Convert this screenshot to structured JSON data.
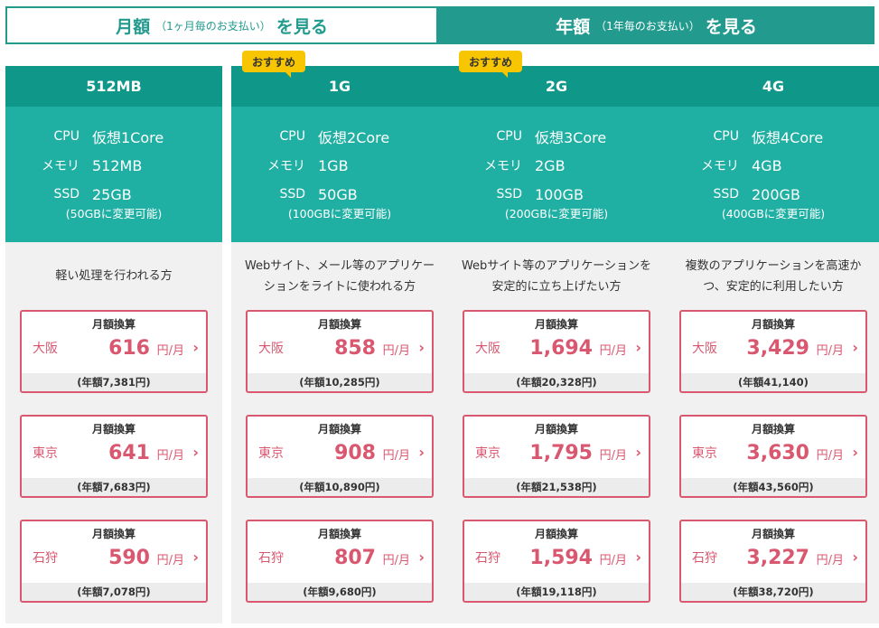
{
  "tabs": {
    "monthly": {
      "main": "月額",
      "sub": "（1ヶ月毎のお支払い）",
      "suffix": "を見る"
    },
    "yearly": {
      "main": "年額",
      "sub": "（1年毎のお支払い）",
      "suffix": "を見る"
    }
  },
  "colors": {
    "teal_dark": "#0f978a",
    "teal": "#1fb0a3",
    "accent": "#d9576f",
    "badge": "#f7c600"
  },
  "box_title": "月額換算",
  "unit": "円/月",
  "spec_labels": {
    "cpu": "CPU",
    "memory": "メモリ",
    "ssd": "SSD"
  },
  "plans": [
    {
      "name": "512MB",
      "badge": "",
      "cpu": "仮想1Core",
      "memory": "512MB",
      "ssd": "25GB",
      "ssd_note": "(50GBに変更可能)",
      "desc": "軽い処理を行われる方",
      "prices": [
        {
          "city": "大阪",
          "price": "616",
          "yearly": "(年額7,381円)"
        },
        {
          "city": "東京",
          "price": "641",
          "yearly": "(年額7,683円)"
        },
        {
          "city": "石狩",
          "price": "590",
          "yearly": "(年額7,078円)"
        }
      ]
    },
    {
      "name": "1G",
      "badge": "おすすめ",
      "cpu": "仮想2Core",
      "memory": "1GB",
      "ssd": "50GB",
      "ssd_note": "(100GBに変更可能)",
      "desc": "Webサイト、メール等のアプリケーションをライトに使われる方",
      "prices": [
        {
          "city": "大阪",
          "price": "858",
          "yearly": "(年額10,285円)"
        },
        {
          "city": "東京",
          "price": "908",
          "yearly": "(年額10,890円)"
        },
        {
          "city": "石狩",
          "price": "807",
          "yearly": "(年額9,680円)"
        }
      ]
    },
    {
      "name": "2G",
      "badge": "おすすめ",
      "cpu": "仮想3Core",
      "memory": "2GB",
      "ssd": "100GB",
      "ssd_note": "(200GBに変更可能)",
      "desc": "Webサイト等のアプリケーションを安定的に立ち上げたい方",
      "prices": [
        {
          "city": "大阪",
          "price": "1,694",
          "yearly": "(年額20,328円)"
        },
        {
          "city": "東京",
          "price": "1,795",
          "yearly": "(年額21,538円)"
        },
        {
          "city": "石狩",
          "price": "1,594",
          "yearly": "(年額19,118円)"
        }
      ]
    },
    {
      "name": "4G",
      "badge": "",
      "cpu": "仮想4Core",
      "memory": "4GB",
      "ssd": "200GB",
      "ssd_note": "(400GBに変更可能)",
      "desc": "複数のアプリケーションを高速かつ、安定的に利用したい方",
      "prices": [
        {
          "city": "大阪",
          "price": "3,429",
          "yearly": "(年額41,140)"
        },
        {
          "city": "東京",
          "price": "3,630",
          "yearly": "(年額43,560円)"
        },
        {
          "city": "石狩",
          "price": "3,227",
          "yearly": "(年額38,720円)"
        }
      ]
    }
  ]
}
